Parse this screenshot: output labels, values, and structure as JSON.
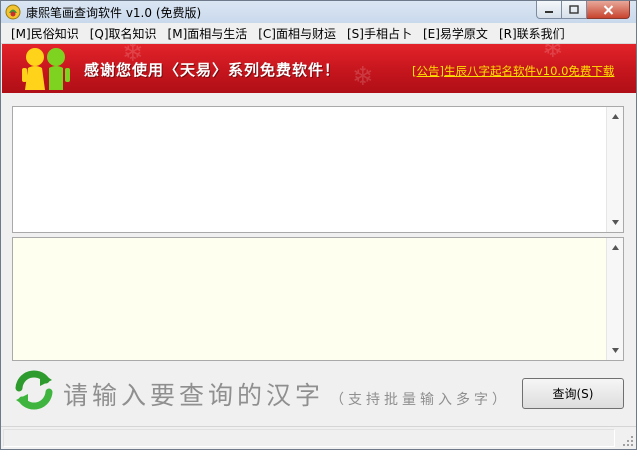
{
  "window": {
    "title": "康熙笔画查询软件 v1.0 (免费版)",
    "icons": {
      "app": "app-icon",
      "minimize": "minimize-icon",
      "maximize": "maximize-icon",
      "close": "close-icon"
    }
  },
  "menu": {
    "items": [
      {
        "label": "[M]民俗知识"
      },
      {
        "label": "[Q]取名知识"
      },
      {
        "label": "[M]面相与生活"
      },
      {
        "label": "[C]面相与财运"
      },
      {
        "label": "[S]手相占卜"
      },
      {
        "label": "[E]易学原文"
      },
      {
        "label": "[R]联系我们"
      }
    ]
  },
  "banner": {
    "text": "感谢您使用〈天易〉系列免费软件！",
    "notice": "[公告]生辰八字起名软件v10.0免费下载",
    "icon": "kids-icon",
    "colors": {
      "background": "#c3141c",
      "notice": "#ffe000"
    }
  },
  "panels": {
    "result_text": "",
    "detail_text": ""
  },
  "bottom": {
    "prompt_main": "请输入要查询的汉字",
    "prompt_sub": "（支持批量输入多字）",
    "query_button": "查询(S)",
    "icon": "refresh-icon"
  },
  "status": {
    "text": ""
  }
}
